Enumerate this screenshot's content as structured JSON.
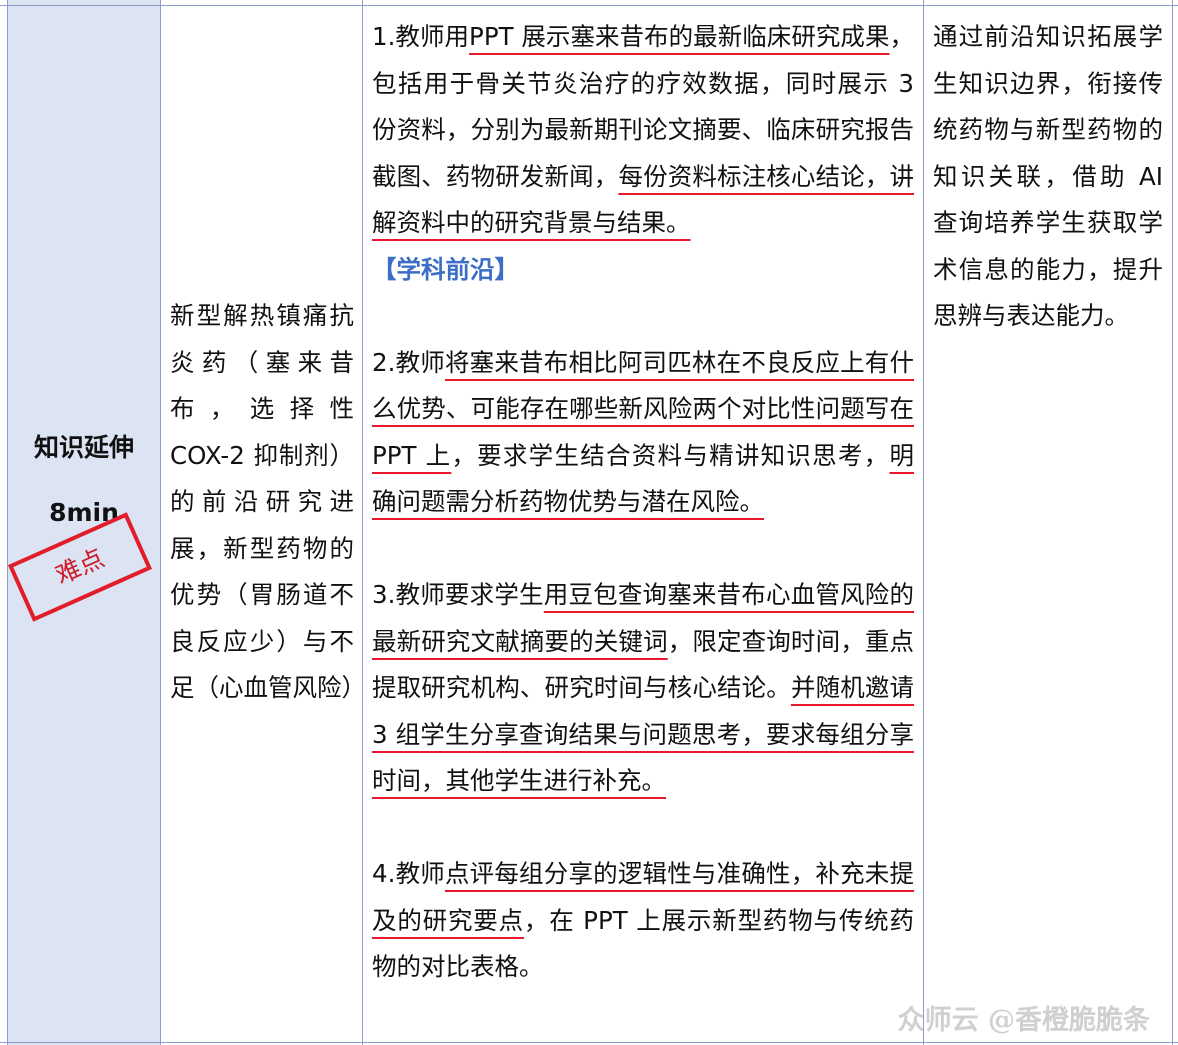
{
  "stage": {
    "title": "知识延伸",
    "duration": "8min",
    "stamp": "难点"
  },
  "content": "新型解热镇痛抗炎药（塞来昔布，选择性 COX-2 抑制剂）的前沿研究进展，新型药物的优势（胃肠道不良反应少）与不足（心血管风险）",
  "steps": [
    {
      "s1": "1.教师用",
      "u1": "PPT 展示塞来昔布的最新临床研究成果",
      "s2": "，包括用于骨关节炎治疗的疗效数据，同时展示 3 份资料，分别为最新期刊论文摘要、临床研究报告截图、药物研发新闻，",
      "u2": "每份资料标注核心结论，讲解资料中的研究背景与结果。",
      "tag": "【学科前沿】"
    },
    {
      "s1": "2.教师",
      "u1": "将塞来昔布相比阿司匹林在不良反应上有什么优势、可能存在哪些新风险两个对比性问题写在 PPT 上",
      "s2": "，要求学生结合资料与精讲知识思考，",
      "u2": "明确问题需分析药物优势与潜在风险。",
      "tag": ""
    },
    {
      "s1": "3.教师要求学生",
      "u1": "用豆包查询塞来昔布心血管风险的最新研究文献摘要的关键词",
      "s2": "，限定查询时间，重点提取研究机构、研究时间与核心结论。",
      "u2": "并随机邀请 3 组学生分享查询结果与问题思考，要求每组分享时间，其他学生进行补充。",
      "tag": ""
    },
    {
      "s1": "4.教师",
      "u1": "点评每组分享的逻辑性与准确性，补充未提及的研究要点",
      "s2": "，在 PPT 上展示新型药物与传统药物的对比表格。",
      "u2": "",
      "tag": ""
    }
  ],
  "intent": "通过前沿知识拓展学生知识边界，衔接传统药物与新型药物的知识关联，借助 AI 查询培养学生获取学术信息的能力，提升思辨与表达能力。",
  "watermark": "众师云 @香橙脆脆条",
  "colors": {
    "stage_bg": "#dce3f3",
    "underline": "#e8192c",
    "tag": "#3d6ec6",
    "border": "#8aa0c8"
  }
}
